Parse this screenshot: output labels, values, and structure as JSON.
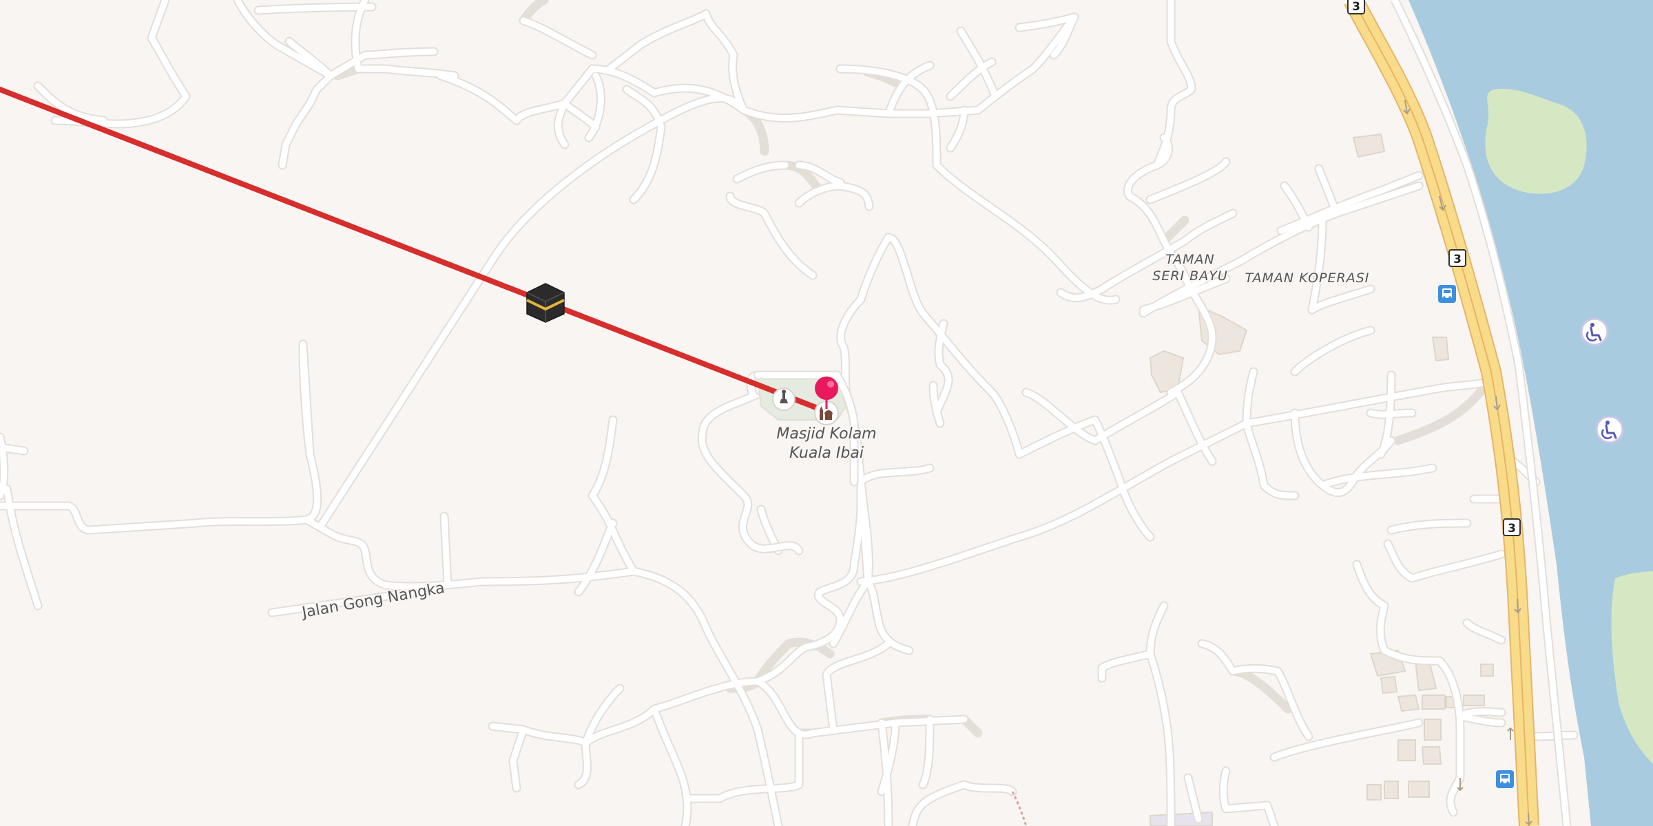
{
  "map": {
    "view": "street-map",
    "colors": {
      "land": "#f8f5f2",
      "road": "#ffffff",
      "road_casing": "#e3ded8",
      "highway": "#f9dc8a",
      "highway_casing": "#e6b46b",
      "water": "#a9cbe0",
      "park": "#d5e8c3",
      "building": "#ece6de",
      "qibla_line": "#d62d2d",
      "marker": "#e8195f"
    },
    "poi": {
      "name_line1": "Masjid Kolam",
      "name_line2": "Kuala Ibai",
      "icon": "mosque-icon"
    },
    "labels": {
      "street_1": "Jalan Gong Nangka",
      "area_1_line1": "TAMAN",
      "area_1_line2": "SERI BAYU",
      "area_2": "TAMAN KOPERASI"
    },
    "route_shields": [
      "3",
      "3",
      "3"
    ],
    "icons": {
      "kaaba": "kaaba-icon",
      "location_pin": "location-pin-icon",
      "bus_stop": "bus-stop-icon",
      "wheelchair": "wheelchair-icon",
      "fountain": "fountain-icon"
    }
  }
}
